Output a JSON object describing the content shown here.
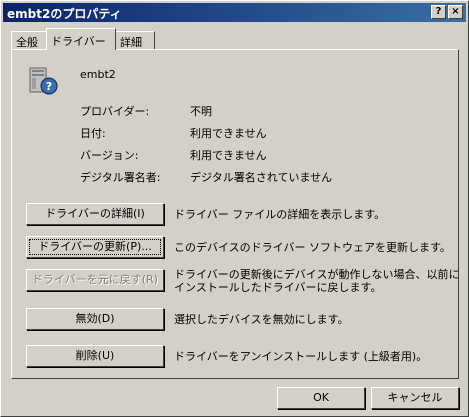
{
  "window": {
    "title": "embt2のプロパティ",
    "help_glyph": "?",
    "close_glyph": "×"
  },
  "tabs": [
    {
      "label": "全般"
    },
    {
      "label": "ドライバー"
    },
    {
      "label": "詳細"
    }
  ],
  "device": {
    "name": "embt2",
    "icon": "unknown-device-icon"
  },
  "info": [
    {
      "label": "プロバイダー:",
      "value": "不明"
    },
    {
      "label": "日付:",
      "value": "利用できません"
    },
    {
      "label": "バージョン:",
      "value": "利用できません"
    },
    {
      "label": "デジタル署名者:",
      "value": "デジタル署名されていません"
    }
  ],
  "actions": [
    {
      "button": "ドライバーの詳細(I)",
      "desc_line1": "ドライバー ファイルの詳細を表示します。",
      "desc_line2": ""
    },
    {
      "button": "ドライバーの更新(P)...",
      "desc_line1": "このデバイスのドライバー ソフトウェアを更新します。",
      "desc_line2": ""
    },
    {
      "button": "ドライバーを元に戻す(R)",
      "desc_line1": "ドライバーの更新後にデバイスが動作しない場合、以前に",
      "desc_line2": "インストールしたドライバーに戻します。"
    },
    {
      "button": "無効(D)",
      "desc_line1": "選択したデバイスを無効にします。",
      "desc_line2": ""
    },
    {
      "button": "削除(U)",
      "desc_line1": "ドライバーをアンインストールします (上級者用)。",
      "desc_line2": ""
    }
  ],
  "footer": {
    "ok": "OK",
    "cancel": "キャンセル"
  }
}
